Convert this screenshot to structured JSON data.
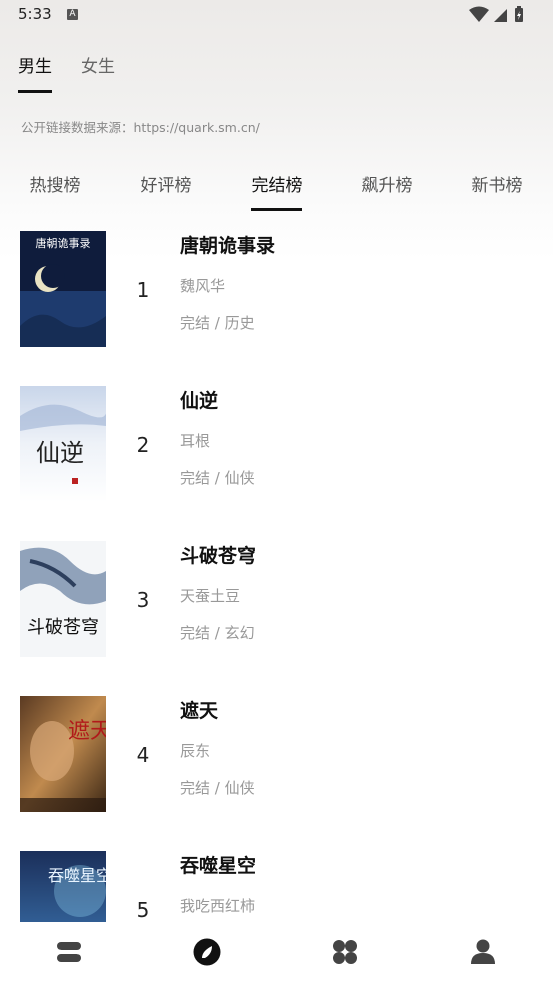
{
  "status_bar": {
    "time": "5:33",
    "notification_icon": "A"
  },
  "gender_tabs": [
    {
      "label": "男生",
      "active": true
    },
    {
      "label": "女生",
      "active": false
    }
  ],
  "source_text": "公开链接数据来源：https://quark.sm.cn/",
  "rank_tabs": [
    {
      "label": "热搜榜",
      "active": false
    },
    {
      "label": "好评榜",
      "active": false
    },
    {
      "label": "完结榜",
      "active": true
    },
    {
      "label": "飙升榜",
      "active": false
    },
    {
      "label": "新书榜",
      "active": false
    }
  ],
  "books": [
    {
      "rank": "1",
      "title": "唐朝诡事录",
      "author": "魏风华",
      "meta": "完结 / 历史",
      "cover_text": "唐朝诡事录"
    },
    {
      "rank": "2",
      "title": "仙逆",
      "author": "耳根",
      "meta": "完结 / 仙侠",
      "cover_text": "仙逆"
    },
    {
      "rank": "3",
      "title": "斗破苍穹",
      "author": "天蚕土豆",
      "meta": "完结 / 玄幻",
      "cover_text": "斗破苍穹"
    },
    {
      "rank": "4",
      "title": "遮天",
      "author": "辰东",
      "meta": "完结 / 仙侠",
      "cover_text": "遮天"
    },
    {
      "rank": "5",
      "title": "吞噬星空",
      "author": "我吃西红柿",
      "meta": "",
      "cover_text": "吞噬星空"
    }
  ],
  "bottom_nav": [
    {
      "icon": "bookshelf-icon",
      "active": false
    },
    {
      "icon": "compass-icon",
      "active": true
    },
    {
      "icon": "category-icon",
      "active": false
    },
    {
      "icon": "profile-icon",
      "active": false
    }
  ],
  "colors": {
    "accent": "#111111",
    "muted_text": "#999999",
    "nav_icon": "#444444"
  }
}
